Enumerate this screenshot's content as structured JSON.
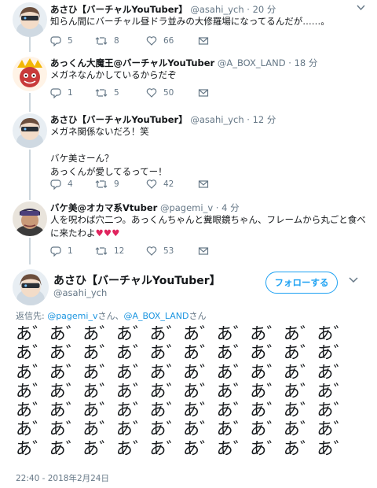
{
  "tweets": [
    {
      "name": "あさひ【バーチャルYouTuber】",
      "handle": "@asahi_ych",
      "time": "20 分",
      "lines": [
        "知らん間にバーチャル昼ドラ並みの大修羅場になってるんだが……。"
      ],
      "replies": "5",
      "retweets": "8",
      "likes": "66"
    },
    {
      "name": "あっくん大魔王@バーチャルYouTuber",
      "handle": "@A_BOX_LAND",
      "time": "18 分",
      "lines": [
        "メガネなんかしているからだぞ"
      ],
      "replies": "1",
      "retweets": "5",
      "likes": "50"
    },
    {
      "name": "あさひ【バーチャルYouTuber】",
      "handle": "@asahi_ych",
      "time": "12 分",
      "lines": [
        "メガネ関係ないだろ！笑",
        "",
        "バケ美さーん？",
        "あっくんが愛してるってー！"
      ],
      "replies": "4",
      "retweets": "9",
      "likes": "42"
    },
    {
      "name": "バケ美@オカマ系Vtuber",
      "handle": "@pagemi_v",
      "time": "4 分",
      "lines": [
        "人を呪わば穴二つ。あっくんちゃんと糞眼鏡ちゃん、フレームから丸ごと食べ",
        "に来たわよ"
      ],
      "hearts": "♥♥♥",
      "replies": "1",
      "retweets": "12",
      "likes": "53"
    }
  ],
  "main_tweet": {
    "name": "あさひ【バーチャルYouTuber】",
    "handle": "@asahi_ych",
    "follow_label": "フォローする",
    "replying_prefix": "返信先: ",
    "replying_user1": "@pagemi_v",
    "replying_mid": "さん、",
    "replying_user2": "@A_BOX_LAND",
    "replying_suffix": "さん",
    "body_lines": [
      "あ゛あ゛あ゛あ゛あ゛あ゛あ゛あ゛あ゛あ゛",
      "あ゛あ゛あ゛あ゛あ゛あ゛あ゛あ゛あ゛あ゛",
      "あ゛あ゛あ゛あ゛あ゛あ゛あ゛あ゛あ゛あ゛",
      "あ゛あ゛あ゛あ゛あ゛あ゛あ゛あ゛あ゛あ゛",
      "あ゛あ゛あ゛あ゛あ゛あ゛あ゛あ゛あ゛あ゛",
      "あ゛あ゛あ゛あ゛あ゛あ゛あ゛あ゛あ゛あ゛",
      "あ゛あ゛あ゛あ゛あ゛あ゛あ゛あ゛あ゛あ゛"
    ],
    "timestamp": "22:40 - 2018年2月24日"
  },
  "icons": {
    "reply": "reply-icon",
    "retweet": "retweet-icon",
    "like": "heart-icon",
    "dm": "message-icon",
    "menu": "chevron-down-icon"
  },
  "colors": {
    "accent": "#1da1f2",
    "muted": "#657786",
    "heart": "#e0245e",
    "thread_line": "#ccd6dd"
  }
}
